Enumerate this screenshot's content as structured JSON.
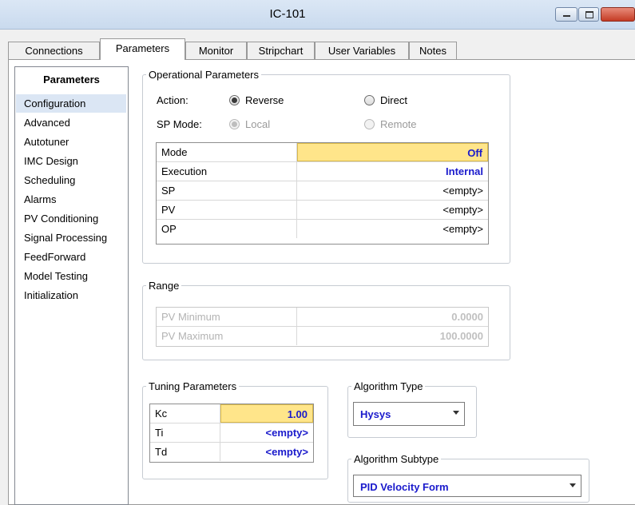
{
  "window": {
    "title": "IC-101"
  },
  "tabs": [
    "Connections",
    "Parameters",
    "Monitor",
    "Stripchart",
    "User Variables",
    "Notes"
  ],
  "nav": {
    "header": "Parameters",
    "items": [
      "Configuration",
      "Advanced",
      "Autotuner",
      "IMC Design",
      "Scheduling",
      "Alarms",
      "PV Conditioning",
      "Signal Processing",
      "FeedForward",
      "Model Testing",
      "Initialization"
    ]
  },
  "operational": {
    "legend": "Operational Parameters",
    "action_label": "Action:",
    "reverse_label": "Reverse",
    "direct_label": "Direct",
    "spmode_label": "SP Mode:",
    "local_label": "Local",
    "remote_label": "Remote",
    "rows": [
      {
        "name": "Mode",
        "value": "Off"
      },
      {
        "name": "Execution",
        "value": "Internal"
      },
      {
        "name": "SP",
        "value": "<empty>"
      },
      {
        "name": "PV",
        "value": "<empty>"
      },
      {
        "name": "OP",
        "value": "<empty>"
      }
    ]
  },
  "range": {
    "legend": "Range",
    "rows": [
      {
        "name": "PV Minimum",
        "value": "0.0000"
      },
      {
        "name": "PV Maximum",
        "value": "100.0000"
      }
    ]
  },
  "tuning": {
    "legend": "Tuning Parameters",
    "rows": [
      {
        "name": "Kc",
        "value": "1.00"
      },
      {
        "name": "Ti",
        "value": "<empty>"
      },
      {
        "name": "Td",
        "value": "<empty>"
      }
    ]
  },
  "algorithm_type": {
    "legend": "Algorithm Type",
    "value": "Hysys"
  },
  "algorithm_subtype": {
    "legend": "Algorithm Subtype",
    "value": "PID Velocity Form"
  },
  "colors": {
    "highlight": "#ffe58a",
    "value_blue": "#1a1acc",
    "selected_nav": "#dbe6f4"
  }
}
